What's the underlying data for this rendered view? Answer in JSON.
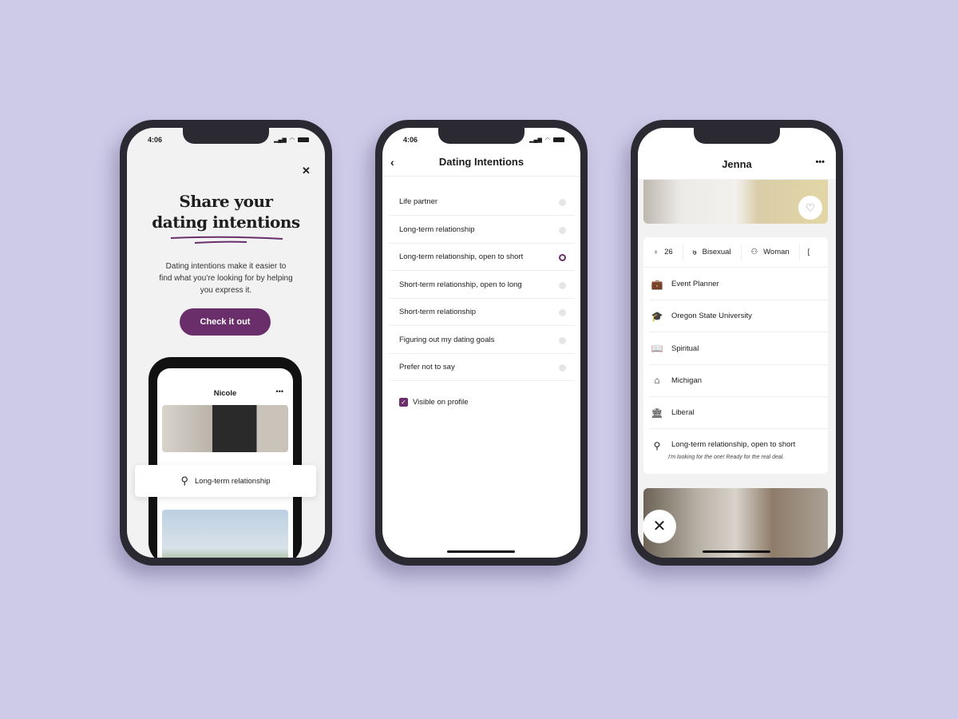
{
  "status_time": "4:06",
  "phone1": {
    "title_line1": "Share your",
    "title_line2": "dating intentions",
    "description": [
      "Dating intentions make it easier to",
      "find what you’re looking for by helping",
      "you express it."
    ],
    "cta_label": "Check it out",
    "inner_profile_name": "Nicole",
    "intention_card": "Long-term relationship"
  },
  "phone2": {
    "header_title": "Dating Intentions",
    "options": [
      {
        "label": "Life partner",
        "selected": false
      },
      {
        "label": "Long-term relationship",
        "selected": false
      },
      {
        "label": "Long-term relationship, open to short",
        "selected": true
      },
      {
        "label": "Short-term relationship, open to long",
        "selected": false
      },
      {
        "label": "Short-term relationship",
        "selected": false
      },
      {
        "label": "Figuring out my dating goals",
        "selected": false
      },
      {
        "label": "Prefer not to say",
        "selected": false
      }
    ],
    "visible_on_profile_label": "Visible on profile",
    "visible_on_profile_checked": true
  },
  "phone3": {
    "profile_name": "Jenna",
    "chips": [
      {
        "icon": "cake-icon",
        "label": "26"
      },
      {
        "icon": "orientation-icon",
        "label": "Bisexual"
      },
      {
        "icon": "person-icon",
        "label": "Woman"
      }
    ],
    "rows": [
      {
        "icon": "briefcase-icon",
        "label": "Event Planner"
      },
      {
        "icon": "graduation-cap-icon",
        "label": "Oregon State University"
      },
      {
        "icon": "book-icon",
        "label": "Spiritual"
      },
      {
        "icon": "home-icon",
        "label": "Michigan"
      },
      {
        "icon": "institution-icon",
        "label": "Liberal"
      },
      {
        "icon": "search-icon",
        "label": "Long-term relationship, open to short"
      }
    ],
    "intention_subtitle": "I'm looking for the one! Ready for the real deal."
  },
  "colors": {
    "background": "#cdcbe7",
    "accent": "#6a2f6a"
  }
}
